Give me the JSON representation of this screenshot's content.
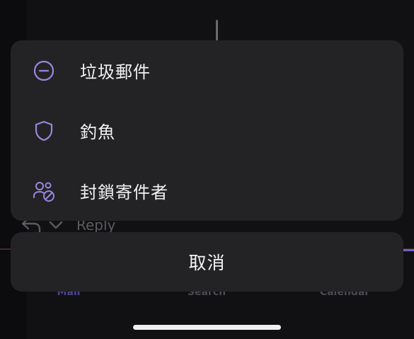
{
  "background": {
    "reply_label": "Reply",
    "tabs": [
      {
        "label": "Mail",
        "active": true
      },
      {
        "label": "Search",
        "active": false
      },
      {
        "label": "Calendar",
        "active": false
      }
    ]
  },
  "action_sheet": {
    "items": [
      {
        "label": "垃圾郵件",
        "icon": "minus-circle-icon"
      },
      {
        "label": "釣魚",
        "icon": "shield-icon"
      },
      {
        "label": "封鎖寄件者",
        "icon": "block-user-icon"
      }
    ],
    "cancel_label": "取消"
  },
  "colors": {
    "accent": "#9a86de",
    "sheet_bg": "#232325",
    "text": "#f2f2f4"
  }
}
